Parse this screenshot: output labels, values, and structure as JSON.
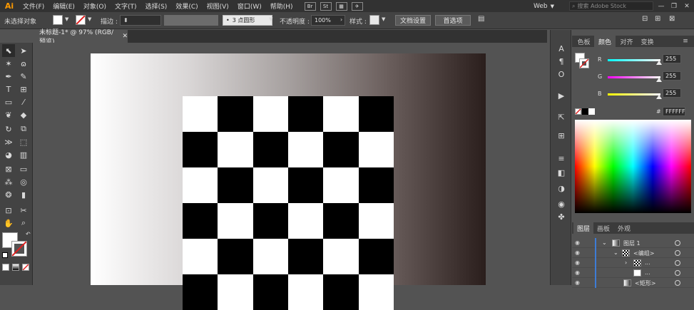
{
  "app": {
    "logo": "Ai"
  },
  "menu": [
    "文件(F)",
    "编辑(E)",
    "对象(O)",
    "文字(T)",
    "选择(S)",
    "效果(C)",
    "视图(V)",
    "窗口(W)",
    "帮助(H)"
  ],
  "bridge_buttons": [
    "Br",
    "St"
  ],
  "workspace": "Web",
  "stock_search": {
    "placeholder": "搜索 Adobe Stock"
  },
  "controlbar": {
    "selection_status": "未选择对象",
    "stroke_label": "描边 :",
    "brush_value": "3 点圆形",
    "opacity_label": "不透明度 :",
    "opacity_value": "100%",
    "style_label": "样式 :",
    "doc_settings": "文档设置",
    "preferences": "首选项"
  },
  "document_tab": {
    "title": "未标题-1* @ 97% (RGB/预览)"
  },
  "color_panel": {
    "tabs": [
      "色板",
      "颜色",
      "对齐",
      "变换"
    ],
    "active_tab": "颜色",
    "channels": [
      {
        "label": "R",
        "value": 255,
        "color": "#ff3b3b"
      },
      {
        "label": "G",
        "value": 255,
        "color": "#ff3bff"
      },
      {
        "label": "B",
        "value": 255,
        "color": "#ffff3b"
      }
    ],
    "hex_prefix": "#",
    "hex_value": "FFFFFF"
  },
  "layers_panel": {
    "tabs": [
      "图层",
      "画板",
      "外观"
    ],
    "active_tab": "图层",
    "rows": [
      {
        "name": "图层 1"
      },
      {
        "name": "<编组>"
      },
      {
        "name": "..."
      },
      {
        "name": "..."
      },
      {
        "name": "<矩形>"
      }
    ]
  },
  "colors": {
    "accent_orange": "#ff9a00",
    "layer_highlight": "#3d7cd6",
    "checker_black": "#000000",
    "checker_white": "#ffffff"
  }
}
